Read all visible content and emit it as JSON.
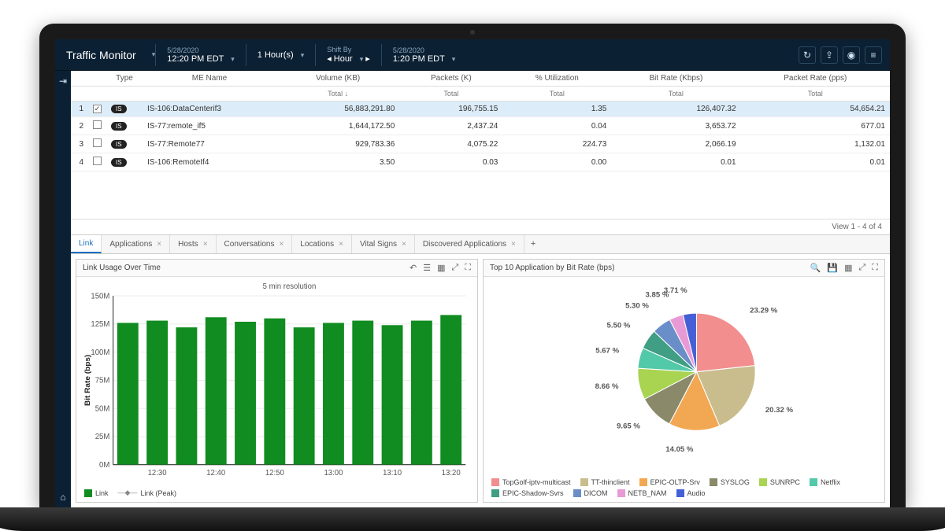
{
  "header": {
    "title": "Traffic Monitor",
    "date_start_sub": "5/28/2020",
    "time_start": "12:20 PM EDT",
    "duration": "1 Hour(s)",
    "shift_by_sub": "Shift By",
    "shift_by_val": "Hour",
    "date_end_sub": "5/28/2020",
    "time_end": "1:20 PM EDT"
  },
  "table": {
    "cols": {
      "type": "Type",
      "me_name": "ME Name",
      "volume": "Volume (KB)",
      "packets": "Packets (K)",
      "util": "% Utilization",
      "bitrate": "Bit Rate (Kbps)",
      "pktrate": "Packet Rate (pps)",
      "total": "Total",
      "total_sort": "Total ↓"
    },
    "rows": [
      {
        "n": "1",
        "sel": true,
        "type": "IS",
        "name": "IS-106:DataCenterif3",
        "vol": "56,883,291.80",
        "pkt": "196,755.15",
        "util": "1.35",
        "br": "126,407.32",
        "pr": "54,654.21"
      },
      {
        "n": "2",
        "sel": false,
        "type": "IS",
        "name": "IS-77:remote_if5",
        "vol": "1,644,172.50",
        "pkt": "2,437.24",
        "util": "0.04",
        "br": "3,653.72",
        "pr": "677.01"
      },
      {
        "n": "3",
        "sel": false,
        "type": "IS",
        "name": "IS-77:Remote77",
        "vol": "929,783.36",
        "pkt": "4,075.22",
        "util": "224.73",
        "br": "2,066.19",
        "pr": "1,132.01"
      },
      {
        "n": "4",
        "sel": false,
        "type": "IS",
        "name": "IS-106:RemoteIf4",
        "vol": "3.50",
        "pkt": "0.03",
        "util": "0.00",
        "br": "0.01",
        "pr": "0.01"
      }
    ],
    "footer": "View 1 - 4 of 4"
  },
  "tabs": {
    "items": [
      {
        "label": "Link",
        "closable": false,
        "active": true
      },
      {
        "label": "Applications",
        "closable": true
      },
      {
        "label": "Hosts",
        "closable": true
      },
      {
        "label": "Conversations",
        "closable": true
      },
      {
        "label": "Locations",
        "closable": true
      },
      {
        "label": "Vital Signs",
        "closable": true
      },
      {
        "label": "Discovered Applications",
        "closable": true
      }
    ]
  },
  "bar_panel": {
    "title": "Link Usage Over Time",
    "subtitle": "5 min resolution",
    "y_title": "Bit Rate (bps)",
    "legend": [
      {
        "label": "Link",
        "sw": "#108c20",
        "type": "box"
      },
      {
        "label": "Link (Peak)",
        "sw": "#888",
        "type": "line"
      }
    ]
  },
  "pie_panel": {
    "title": "Top 10 Application by Bit Rate (bps)",
    "legend": [
      {
        "label": "TopGolf-iptv-multicast",
        "color": "#f28e8e"
      },
      {
        "label": "TT-thinclient",
        "color": "#c9bd8e"
      },
      {
        "label": "EPIC-OLTP-Srv",
        "color": "#f2a852"
      },
      {
        "label": "SYSLOG",
        "color": "#8a8a6a"
      },
      {
        "label": "SUNRPC",
        "color": "#a8d452"
      },
      {
        "label": "Netflix",
        "color": "#52c9a8"
      },
      {
        "label": "EPIC-Shadow-Svrs",
        "color": "#3f9e84"
      },
      {
        "label": "DICOM",
        "color": "#6a8ec7"
      },
      {
        "label": "NETB_NAM",
        "color": "#e89ad6"
      },
      {
        "label": "Audio",
        "color": "#4560d6"
      }
    ]
  },
  "chart_data": [
    {
      "type": "bar",
      "title": "Link Usage Over Time",
      "subtitle": "5 min resolution",
      "ylabel": "Bit Rate (bps)",
      "ylim": [
        0,
        150
      ],
      "y_unit": "M",
      "y_ticks": [
        0,
        25,
        50,
        75,
        100,
        125,
        150
      ],
      "x_ticks": [
        "12:30",
        "12:40",
        "12:50",
        "13:00",
        "13:10",
        "13:20"
      ],
      "categories": [
        "12:25",
        "12:30",
        "12:35",
        "12:40",
        "12:45",
        "12:50",
        "12:55",
        "13:00",
        "13:05",
        "13:10",
        "13:15",
        "13:20"
      ],
      "series": [
        {
          "name": "Link",
          "values": [
            126,
            128,
            122,
            131,
            127,
            130,
            122,
            126,
            128,
            124,
            128,
            133
          ]
        }
      ]
    },
    {
      "type": "pie",
      "title": "Top 10 Application by Bit Rate (bps)",
      "slices": [
        {
          "name": "TopGolf-iptv-multicast",
          "pct": 23.29,
          "color": "#f28e8e"
        },
        {
          "name": "TT-thinclient",
          "pct": 20.32,
          "color": "#c9bd8e"
        },
        {
          "name": "EPIC-OLTP-Srv",
          "pct": 14.05,
          "color": "#f2a852"
        },
        {
          "name": "SYSLOG",
          "pct": 9.65,
          "color": "#8a8a6a"
        },
        {
          "name": "SUNRPC",
          "pct": 8.66,
          "color": "#a8d452"
        },
        {
          "name": "Netflix",
          "pct": 5.67,
          "color": "#52c9a8"
        },
        {
          "name": "EPIC-Shadow-Svrs",
          "pct": 5.5,
          "color": "#3f9e84"
        },
        {
          "name": "DICOM",
          "pct": 5.3,
          "color": "#6a8ec7"
        },
        {
          "name": "NETB_NAM",
          "pct": 3.85,
          "color": "#e89ad6"
        },
        {
          "name": "Audio",
          "pct": 3.71,
          "color": "#4560d6"
        }
      ]
    }
  ]
}
